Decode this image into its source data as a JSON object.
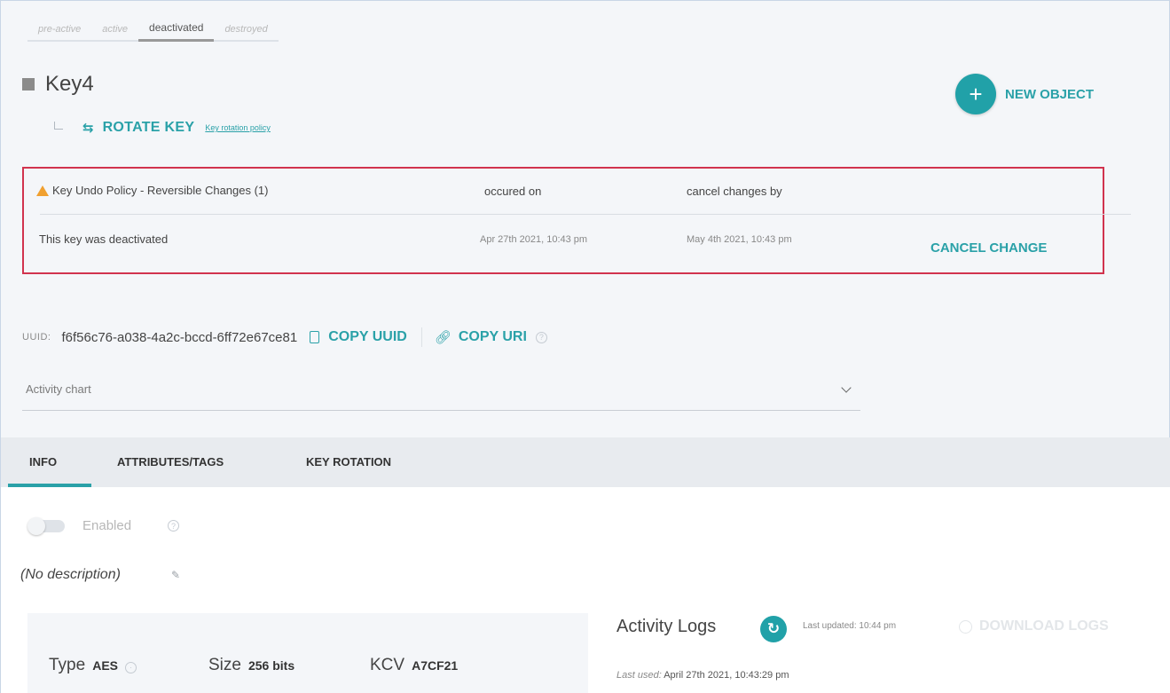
{
  "lifecycle": {
    "steps": [
      "pre-active",
      "active",
      "deactivated",
      "destroyed"
    ],
    "current": "deactivated"
  },
  "header": {
    "key_name": "Key4",
    "rotate_label": "ROTATE KEY",
    "rotation_policy_link": "Key rotation policy",
    "new_object_label": "NEW OBJECT"
  },
  "undo_policy": {
    "title": "Key Undo Policy - Reversible Changes (1)",
    "col_occured": "occured on",
    "col_cancel_by": "cancel changes by",
    "message": "This key was deactivated",
    "occured_on": "Apr 27th 2021, 10:43 pm",
    "cancel_by": "May 4th 2021, 10:43 pm",
    "cancel_label": "CANCEL CHANGE"
  },
  "uuid": {
    "label": "UUID:",
    "value": "f6f56c76-a038-4a2c-bccd-6ff72e67ce81",
    "copy_uuid_label": "COPY UUID",
    "copy_uri_label": "COPY URI"
  },
  "activity_chart": {
    "label": "Activity chart"
  },
  "tabs": [
    {
      "label": "INFO",
      "active": true
    },
    {
      "label": "ATTRIBUTES/TAGS",
      "active": false
    },
    {
      "label": "KEY ROTATION",
      "active": false
    }
  ],
  "info": {
    "enabled_label": "Enabled",
    "enabled": false,
    "description": "(No description)",
    "type_key": "Type",
    "type_value": "AES",
    "size_key": "Size",
    "size_value": "256 bits",
    "kcv_key": "KCV",
    "kcv_value": "A7CF21"
  },
  "logs": {
    "title": "Activity Logs",
    "last_updated": "Last updated: 10:44 pm",
    "download_label": "DOWNLOAD LOGS",
    "last_used_label": "Last used:",
    "last_used_value": "April 27th 2021, 10:43:29 pm"
  },
  "colors": {
    "accent": "#2aa1a8",
    "alert_border": "#d1334e",
    "warning": "#f0a030"
  }
}
